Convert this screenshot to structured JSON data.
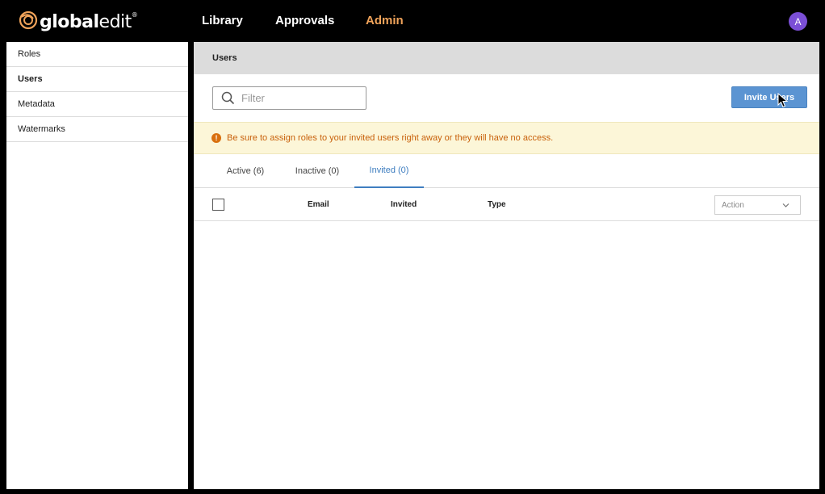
{
  "brand": {
    "logo_text_bold": "global",
    "logo_text_light": "edit",
    "logo_mark": "®",
    "accent_color": "#f0a35a"
  },
  "nav": {
    "library": "Library",
    "approvals": "Approvals",
    "admin": "Admin",
    "active": "Admin"
  },
  "user": {
    "avatar_initial": "A",
    "avatar_color": "#7b4fd6"
  },
  "sidebar": {
    "items": [
      {
        "label": "Roles",
        "active": false
      },
      {
        "label": "Users",
        "active": true
      },
      {
        "label": "Metadata",
        "active": false
      },
      {
        "label": "Watermarks",
        "active": false
      }
    ]
  },
  "page": {
    "title": "Users",
    "filter_placeholder": "Filter",
    "invite_button": "Invite Users",
    "alert": "Be sure to assign roles to your invited users right away or they will have no access."
  },
  "tabs": [
    {
      "label": "Active (6)",
      "active": false
    },
    {
      "label": "Inactive (0)",
      "active": false
    },
    {
      "label": "Invited (0)",
      "active": true
    }
  ],
  "table": {
    "columns": [
      "Email",
      "Invited",
      "Type"
    ],
    "action_select": "Action"
  }
}
